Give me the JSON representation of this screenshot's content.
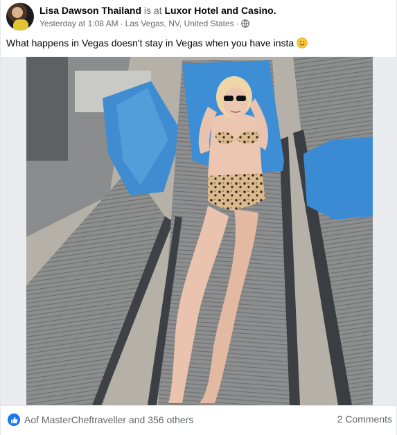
{
  "post": {
    "author": "Lisa Dawson Thailand",
    "checkin_text": " is at ",
    "location": "Luxor Hotel and Casino.",
    "timestamp": "Yesterday at 1:08 AM",
    "separator": "·",
    "place": "Las Vegas, NV, United States",
    "meta_separator": "·",
    "privacy_icon": "globe-icon",
    "caption": "What happens in Vegas doesn't stay in Vegas when you have insta",
    "caption_emoji": "slightly-smiling-face-emoji"
  },
  "photo": {
    "subject": "woman in leopard-print bikini lounging on a poolside chaise with blue towels"
  },
  "footer": {
    "reactions_icon": "like-icon",
    "reactions_text": "Aof MasterCheftraveller and 356 others",
    "comments_text": "2 Comments"
  },
  "colors": {
    "accent": "#1877f2",
    "secondary_text": "#65676b",
    "towel_blue": "#3d8fd4"
  }
}
